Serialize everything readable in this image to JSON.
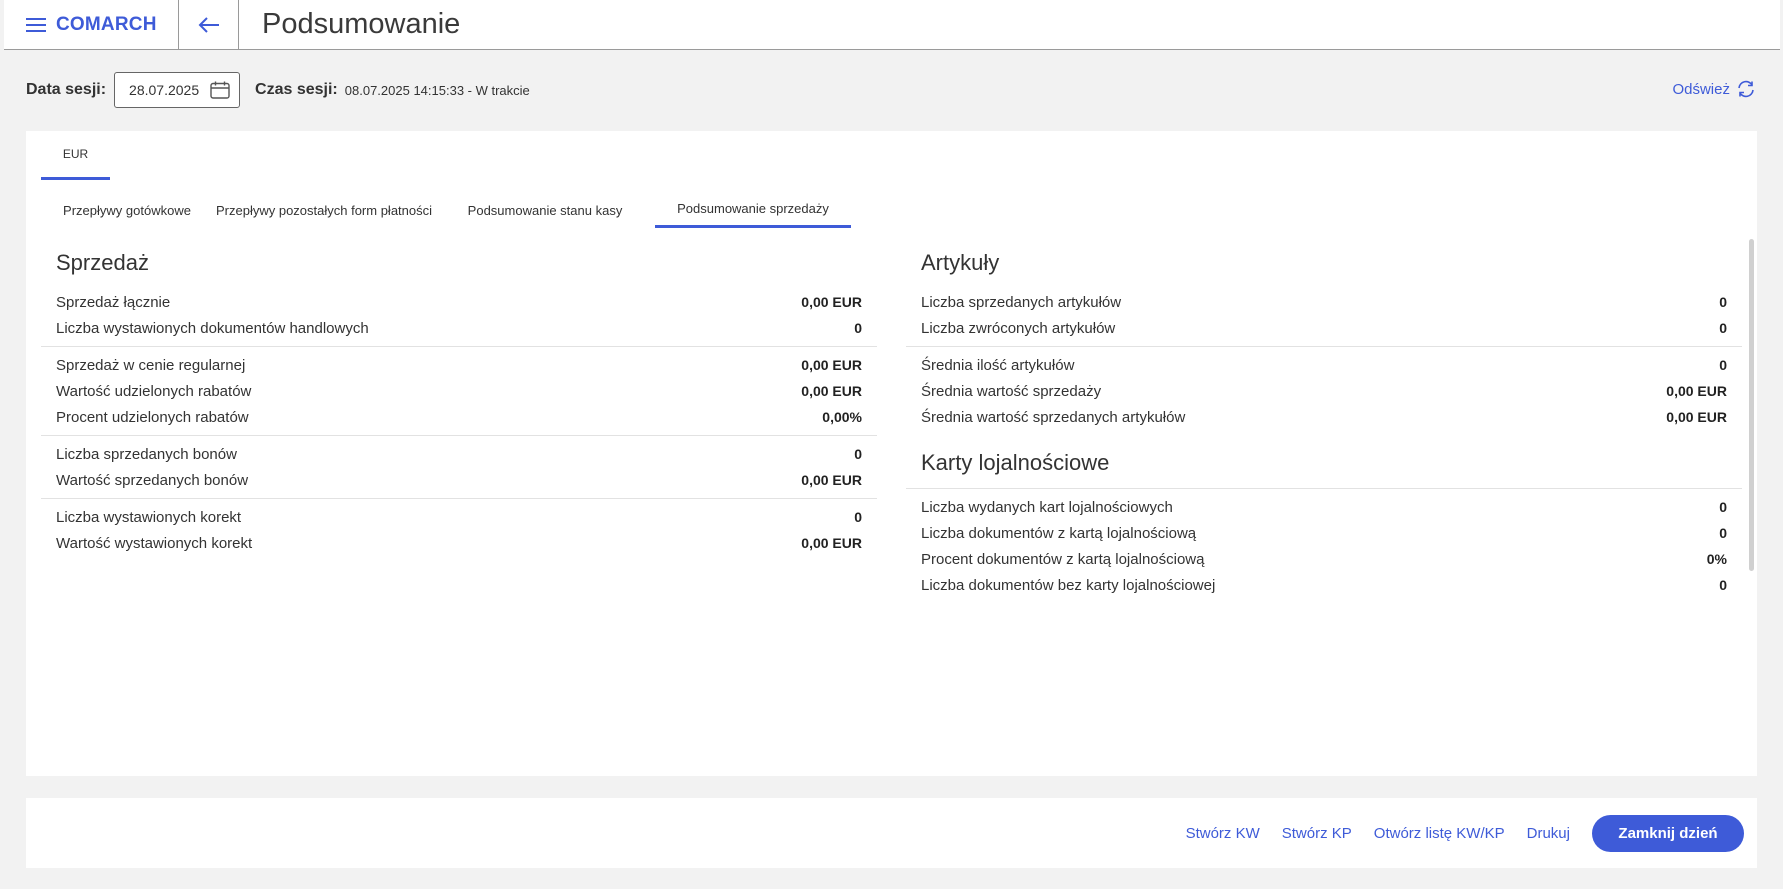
{
  "header": {
    "brand": "COMARCH",
    "title": "Podsumowanie"
  },
  "session": {
    "date_label": "Data sesji:",
    "date_value": "28.07.2025",
    "time_label": "Czas sesji:",
    "time_value": "08.07.2025 14:15:33 - W trakcie",
    "refresh_label": "Odśwież"
  },
  "currency_tab": "EUR",
  "tabs": [
    {
      "label": "Przepływy gotówkowe",
      "active": false
    },
    {
      "label": "Przepływy pozostałych form płatności",
      "active": false
    },
    {
      "label": "Podsumowanie stanu kasy",
      "active": false
    },
    {
      "label": "Podsumowanie sprzedaży",
      "active": true
    }
  ],
  "sales": {
    "title": "Sprzedaż",
    "groups": [
      [
        {
          "label": "Sprzedaż łącznie",
          "value": "0,00 EUR"
        },
        {
          "label": "Liczba wystawionych dokumentów handlowych",
          "value": "0"
        }
      ],
      [
        {
          "label": "Sprzedaż w cenie regularnej",
          "value": "0,00 EUR"
        },
        {
          "label": "Wartość udzielonych rabatów",
          "value": "0,00 EUR"
        },
        {
          "label": "Procent udzielonych rabatów",
          "value": "0,00%"
        }
      ],
      [
        {
          "label": "Liczba sprzedanych bonów",
          "value": "0"
        },
        {
          "label": "Wartość sprzedanych bonów",
          "value": "0,00 EUR"
        }
      ],
      [
        {
          "label": "Liczba wystawionych korekt",
          "value": "0"
        },
        {
          "label": "Wartość wystawionych korekt",
          "value": "0,00 EUR"
        }
      ]
    ]
  },
  "articles": {
    "title": "Artykuły",
    "groups": [
      [
        {
          "label": "Liczba sprzedanych artykułów",
          "value": "0"
        },
        {
          "label": "Liczba zwróconych artykułów",
          "value": "0"
        }
      ],
      [
        {
          "label": "Średnia ilość artykułów",
          "value": "0"
        },
        {
          "label": "Średnia wartość sprzedaży",
          "value": "0,00 EUR"
        },
        {
          "label": "Średnia wartość sprzedanych artykułów",
          "value": "0,00 EUR"
        }
      ]
    ]
  },
  "loyalty": {
    "title": "Karty lojalnościowe",
    "rows": [
      {
        "label": "Liczba wydanych kart lojalnościowych",
        "value": "0"
      },
      {
        "label": "Liczba dokumentów z kartą lojalnościową",
        "value": "0"
      },
      {
        "label": "Procent dokumentów z kartą lojalnościową",
        "value": "0%"
      },
      {
        "label": "Liczba dokumentów bez karty lojalnościowej",
        "value": "0"
      }
    ]
  },
  "footer": {
    "create_kw": "Stwórz KW",
    "create_kp": "Stwórz KP",
    "open_list": "Otwórz listę KW/KP",
    "print": "Drukuj",
    "close_day": "Zamknij dzień"
  },
  "colors": {
    "accent": "#3e5bd8"
  }
}
